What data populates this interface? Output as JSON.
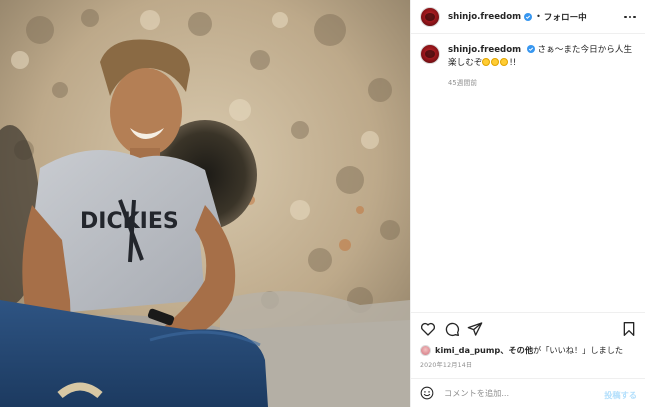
{
  "photo": {
    "alt_icon": "post-photo",
    "shirt_text": "DICKIES"
  },
  "header": {
    "username": "shinjo.freedom",
    "separator": "•",
    "follow_label": "フォロー中",
    "more_icon": "more-horizontal-icon"
  },
  "caption": {
    "username": "shinjo.freedom",
    "text_main": "さぁ〜また今日から人生楽しむぞ",
    "text_end": "!!",
    "emoji_count": 3,
    "time_ago": "45週間前"
  },
  "actions": {
    "like_icon": "heart-icon",
    "comment_icon": "comment-icon",
    "share_icon": "send-icon",
    "save_icon": "bookmark-icon"
  },
  "likes": {
    "user": "kimi_da_pump",
    "others": "、その他",
    "suffix": "が「いいね！」しました"
  },
  "date": "2020年12月14日",
  "comment_box": {
    "placeholder": "コメントを追加...",
    "post_label": "投稿する"
  },
  "colors": {
    "text": "#262626",
    "muted": "#8e8e8e",
    "verified": "#3897f0",
    "post_disabled": "#b2dffc",
    "border": "#efefef"
  }
}
